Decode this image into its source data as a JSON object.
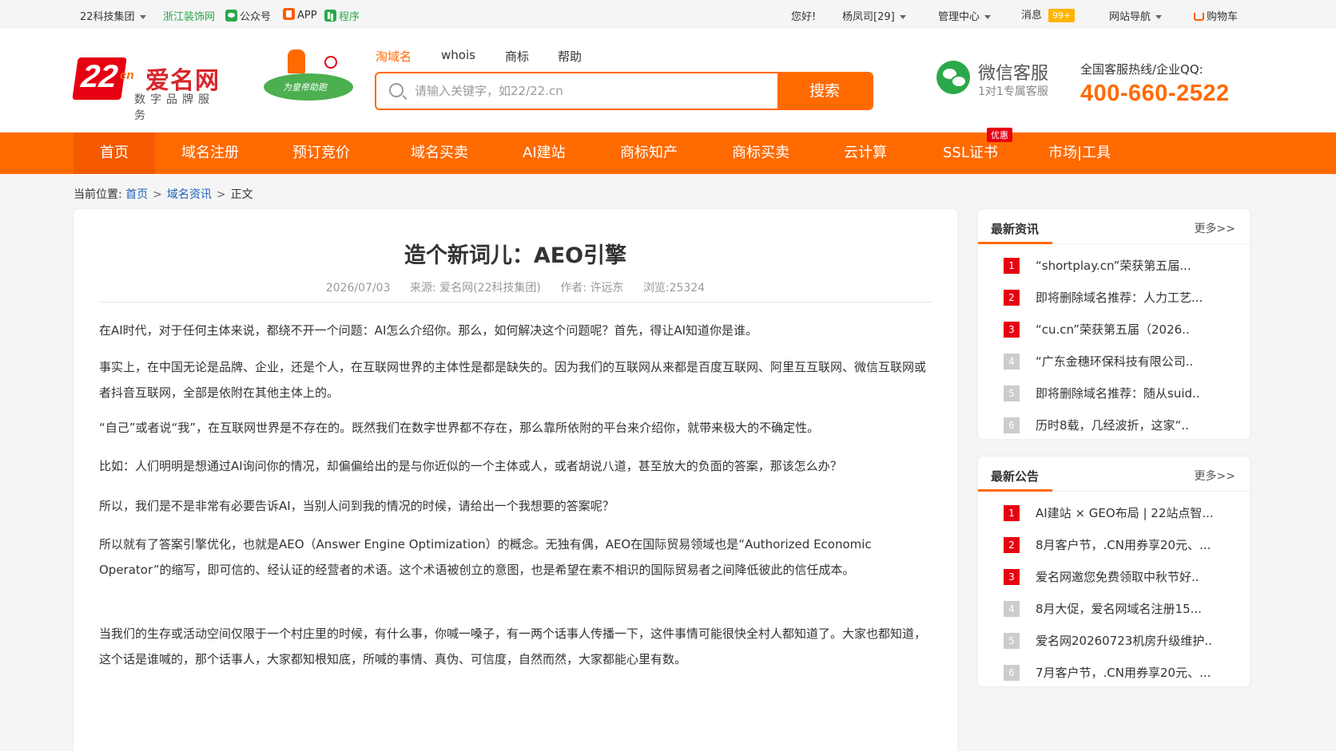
{
  "topbar": {
    "group": "22科技集团",
    "zhejiang": "浙江装饰网",
    "wechat_public": "公众号",
    "app": "APP",
    "mini_program": "程序",
    "greeting": "您好!",
    "user": "杨凤司[29]",
    "manage": "管理中心",
    "messages": "消息",
    "message_count": "99+",
    "site_nav": "网站导航",
    "cart": "购物车"
  },
  "header": {
    "logo_number": "22",
    "logo_cn": "cn",
    "logo_name": "爱名网",
    "logo_sub": "数字品牌服务",
    "mascot_text": "为皇帝助跑",
    "search_tabs": [
      "淘域名",
      "whois",
      "商标",
      "帮助"
    ],
    "search_placeholder": "请输入关键字，如22/22.cn",
    "search_button": "搜索",
    "wx_title": "微信客服",
    "wx_sub": "1对1专属客服",
    "hotline_label": "全国客服热线/企业QQ:",
    "hotline_number": "400-660-2522"
  },
  "nav": {
    "items": [
      "首页",
      "域名注册",
      "预订竞价",
      "域名买卖",
      "AI建站",
      "商标知产",
      "商标买卖",
      "云计算",
      "SSL证书",
      "市场|工具"
    ],
    "promo_tag": "优惠"
  },
  "breadcrumb": {
    "label": "当前位置:",
    "home": "首页",
    "category": "域名资讯",
    "current": "正文",
    "sep": ">"
  },
  "article": {
    "title": "造个新词儿：AEO引擎",
    "date": "2026/07/03",
    "source": "来源: 爱名网(22科技集团)",
    "author": "作者: 许远东",
    "views": "浏览:25324",
    "paragraphs": [
      "在AI时代，对于任何主体来说，都绕不开一个问题：AI怎么介绍你。那么，如何解决这个问题呢？首先，得让AI知道你是谁。",
      "事实上，在中国无论是品牌、企业，还是个人，在互联网世界的主体性是都是缺失的。因为我们的互联网从来都是百度互联网、阿里互互联网、微信互联网或者抖音互联网，全部是依附在其他主体上的。",
      "“自己”或者说“我”，在互联网世界是不存在的。既然我们在数字世界都不存在，那么靠所依附的平台来介绍你，就带来极大的不确定性。",
      "比如：人们明明是想通过AI询问你的情况，却偏偏给出的是与你近似的一个主体或人，或者胡说八道，甚至放大的负面的答案，那该怎么办？",
      "所以，我们是不是非常有必要告诉AI，当别人问到我的情况的时候，请给出一个我想要的答案呢？",
      "所以就有了答案引擎优化，也就是AEO（Answer Engine Optimization）的概念。无独有偶，AEO在国际贸易领域也是“Authorized Economic Operator”的缩写，即可信的、经认证的经营者的术语。这个术语被创立的意图，也是希望在素不相识的国际贸易者之间降低彼此的信任成本。",
      "当我们的生存或活动空间仅限于一个村庄里的时候，有什么事，你喊一嗓子，有一两个话事人传播一下，这件事情可能很快全村人都知道了。大家也都知道，这个话是谁喊的，那个话事人，大家都知根知底，所喊的事情、真伪、可信度，自然而然，大家都能心里有数。"
    ]
  },
  "latest_news": {
    "title": "最新资讯",
    "more": "更多>>",
    "items": [
      {
        "num": "1",
        "text": "“shortplay.cn”荣获第五届..."
      },
      {
        "num": "2",
        "text": "即将删除域名推荐：人力工艺..."
      },
      {
        "num": "3",
        "text": "“cu.cn”荣获第五届（2026.."
      },
      {
        "num": "4",
        "text": "“广东金穗环保科技有限公司.."
      },
      {
        "num": "5",
        "text": "即将删除域名推荐：随从suid.."
      },
      {
        "num": "6",
        "text": "历时8载，几经波折，这家“.."
      }
    ]
  },
  "latest_notice": {
    "title": "最新公告",
    "more": "更多>>",
    "items": [
      {
        "num": "1",
        "text": "AI建站 × GEO布局 | 22站点智..."
      },
      {
        "num": "2",
        "text": "8月客户节，.CN用券享20元、..."
      },
      {
        "num": "3",
        "text": "爱名网邀您免费领取中秋节好.."
      },
      {
        "num": "4",
        "text": "8月大促，爱名网域名注册15..."
      },
      {
        "num": "5",
        "text": "爱名网20260723机房升级维护.."
      },
      {
        "num": "6",
        "text": "7月客户节，.CN用券享20元、..."
      }
    ]
  }
}
